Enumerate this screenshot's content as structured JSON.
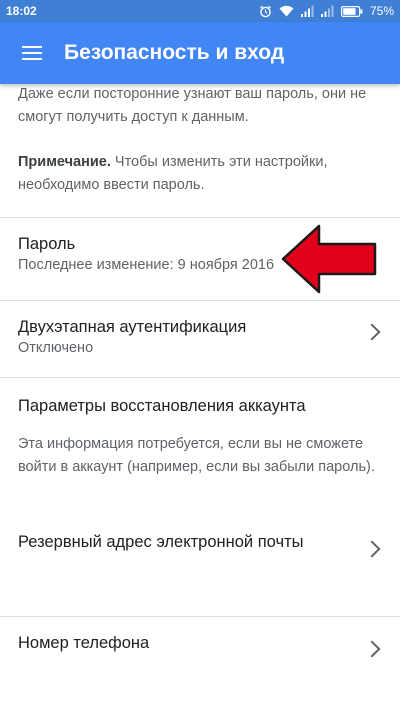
{
  "status_bar": {
    "time": "18:02",
    "battery": "75%",
    "icons": [
      "alarm-icon",
      "wifi-icon",
      "signal-icon",
      "signal-icon",
      "battery-icon"
    ]
  },
  "app_bar": {
    "title": "Безопасность и вход",
    "menu_icon": "menu-icon"
  },
  "intro": {
    "text": "Даже если посторонние узнают ваш пароль, они не смогут получить доступ к данным.",
    "note_label": "Примечание.",
    "note_text": " Чтобы изменить эти настройки, необходимо ввести пароль."
  },
  "items": {
    "password": {
      "label": "Пароль",
      "sub": "Последнее изменение: 9 ноября 2016"
    },
    "two_step": {
      "label": "Двухэтапная аутентификация",
      "sub": "Отключено"
    },
    "recovery": {
      "label": "Параметры восстановления аккаунта",
      "desc": "Эта информация потребуется, если вы не сможете войти в аккаунт (например, если вы забыли пароль)."
    },
    "backup_email": {
      "label": "Резервный адрес электронной почты"
    },
    "phone": {
      "label": "Номер телефона"
    }
  },
  "colors": {
    "app_bar": "#4285f4",
    "status_bar": "#3f7fd6",
    "arrow": "#e2001a"
  }
}
